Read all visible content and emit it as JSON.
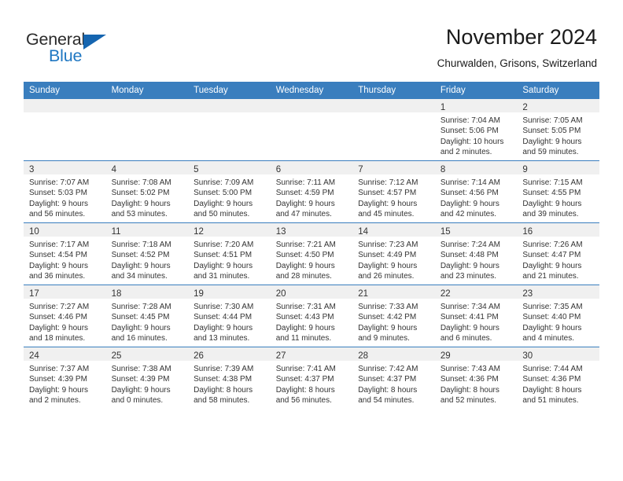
{
  "logo": {
    "word_top": "General",
    "word_bottom": "Blue",
    "triangle_icon": "triangle-icon",
    "color_blue": "#1565b0",
    "color_text": "#2b2b2b"
  },
  "header": {
    "title": "November 2024",
    "subtitle": "Churwalden, Grisons, Switzerland"
  },
  "theme": {
    "header_blue": "#3a7ebe",
    "daynum_band": "#f0f0f0",
    "text": "#333333"
  },
  "weekday_headers": [
    "Sunday",
    "Monday",
    "Tuesday",
    "Wednesday",
    "Thursday",
    "Friday",
    "Saturday"
  ],
  "weeks": [
    [
      {
        "empty": true
      },
      {
        "empty": true
      },
      {
        "empty": true
      },
      {
        "empty": true
      },
      {
        "empty": true
      },
      {
        "day": "1",
        "sunrise": "Sunrise: 7:04 AM",
        "sunset": "Sunset: 5:06 PM",
        "daylight_1": "Daylight: 10 hours",
        "daylight_2": "and 2 minutes."
      },
      {
        "day": "2",
        "sunrise": "Sunrise: 7:05 AM",
        "sunset": "Sunset: 5:05 PM",
        "daylight_1": "Daylight: 9 hours",
        "daylight_2": "and 59 minutes."
      }
    ],
    [
      {
        "day": "3",
        "sunrise": "Sunrise: 7:07 AM",
        "sunset": "Sunset: 5:03 PM",
        "daylight_1": "Daylight: 9 hours",
        "daylight_2": "and 56 minutes."
      },
      {
        "day": "4",
        "sunrise": "Sunrise: 7:08 AM",
        "sunset": "Sunset: 5:02 PM",
        "daylight_1": "Daylight: 9 hours",
        "daylight_2": "and 53 minutes."
      },
      {
        "day": "5",
        "sunrise": "Sunrise: 7:09 AM",
        "sunset": "Sunset: 5:00 PM",
        "daylight_1": "Daylight: 9 hours",
        "daylight_2": "and 50 minutes."
      },
      {
        "day": "6",
        "sunrise": "Sunrise: 7:11 AM",
        "sunset": "Sunset: 4:59 PM",
        "daylight_1": "Daylight: 9 hours",
        "daylight_2": "and 47 minutes."
      },
      {
        "day": "7",
        "sunrise": "Sunrise: 7:12 AM",
        "sunset": "Sunset: 4:57 PM",
        "daylight_1": "Daylight: 9 hours",
        "daylight_2": "and 45 minutes."
      },
      {
        "day": "8",
        "sunrise": "Sunrise: 7:14 AM",
        "sunset": "Sunset: 4:56 PM",
        "daylight_1": "Daylight: 9 hours",
        "daylight_2": "and 42 minutes."
      },
      {
        "day": "9",
        "sunrise": "Sunrise: 7:15 AM",
        "sunset": "Sunset: 4:55 PM",
        "daylight_1": "Daylight: 9 hours",
        "daylight_2": "and 39 minutes."
      }
    ],
    [
      {
        "day": "10",
        "sunrise": "Sunrise: 7:17 AM",
        "sunset": "Sunset: 4:54 PM",
        "daylight_1": "Daylight: 9 hours",
        "daylight_2": "and 36 minutes."
      },
      {
        "day": "11",
        "sunrise": "Sunrise: 7:18 AM",
        "sunset": "Sunset: 4:52 PM",
        "daylight_1": "Daylight: 9 hours",
        "daylight_2": "and 34 minutes."
      },
      {
        "day": "12",
        "sunrise": "Sunrise: 7:20 AM",
        "sunset": "Sunset: 4:51 PM",
        "daylight_1": "Daylight: 9 hours",
        "daylight_2": "and 31 minutes."
      },
      {
        "day": "13",
        "sunrise": "Sunrise: 7:21 AM",
        "sunset": "Sunset: 4:50 PM",
        "daylight_1": "Daylight: 9 hours",
        "daylight_2": "and 28 minutes."
      },
      {
        "day": "14",
        "sunrise": "Sunrise: 7:23 AM",
        "sunset": "Sunset: 4:49 PM",
        "daylight_1": "Daylight: 9 hours",
        "daylight_2": "and 26 minutes."
      },
      {
        "day": "15",
        "sunrise": "Sunrise: 7:24 AM",
        "sunset": "Sunset: 4:48 PM",
        "daylight_1": "Daylight: 9 hours",
        "daylight_2": "and 23 minutes."
      },
      {
        "day": "16",
        "sunrise": "Sunrise: 7:26 AM",
        "sunset": "Sunset: 4:47 PM",
        "daylight_1": "Daylight: 9 hours",
        "daylight_2": "and 21 minutes."
      }
    ],
    [
      {
        "day": "17",
        "sunrise": "Sunrise: 7:27 AM",
        "sunset": "Sunset: 4:46 PM",
        "daylight_1": "Daylight: 9 hours",
        "daylight_2": "and 18 minutes."
      },
      {
        "day": "18",
        "sunrise": "Sunrise: 7:28 AM",
        "sunset": "Sunset: 4:45 PM",
        "daylight_1": "Daylight: 9 hours",
        "daylight_2": "and 16 minutes."
      },
      {
        "day": "19",
        "sunrise": "Sunrise: 7:30 AM",
        "sunset": "Sunset: 4:44 PM",
        "daylight_1": "Daylight: 9 hours",
        "daylight_2": "and 13 minutes."
      },
      {
        "day": "20",
        "sunrise": "Sunrise: 7:31 AM",
        "sunset": "Sunset: 4:43 PM",
        "daylight_1": "Daylight: 9 hours",
        "daylight_2": "and 11 minutes."
      },
      {
        "day": "21",
        "sunrise": "Sunrise: 7:33 AM",
        "sunset": "Sunset: 4:42 PM",
        "daylight_1": "Daylight: 9 hours",
        "daylight_2": "and 9 minutes."
      },
      {
        "day": "22",
        "sunrise": "Sunrise: 7:34 AM",
        "sunset": "Sunset: 4:41 PM",
        "daylight_1": "Daylight: 9 hours",
        "daylight_2": "and 6 minutes."
      },
      {
        "day": "23",
        "sunrise": "Sunrise: 7:35 AM",
        "sunset": "Sunset: 4:40 PM",
        "daylight_1": "Daylight: 9 hours",
        "daylight_2": "and 4 minutes."
      }
    ],
    [
      {
        "day": "24",
        "sunrise": "Sunrise: 7:37 AM",
        "sunset": "Sunset: 4:39 PM",
        "daylight_1": "Daylight: 9 hours",
        "daylight_2": "and 2 minutes."
      },
      {
        "day": "25",
        "sunrise": "Sunrise: 7:38 AM",
        "sunset": "Sunset: 4:39 PM",
        "daylight_1": "Daylight: 9 hours",
        "daylight_2": "and 0 minutes."
      },
      {
        "day": "26",
        "sunrise": "Sunrise: 7:39 AM",
        "sunset": "Sunset: 4:38 PM",
        "daylight_1": "Daylight: 8 hours",
        "daylight_2": "and 58 minutes."
      },
      {
        "day": "27",
        "sunrise": "Sunrise: 7:41 AM",
        "sunset": "Sunset: 4:37 PM",
        "daylight_1": "Daylight: 8 hours",
        "daylight_2": "and 56 minutes."
      },
      {
        "day": "28",
        "sunrise": "Sunrise: 7:42 AM",
        "sunset": "Sunset: 4:37 PM",
        "daylight_1": "Daylight: 8 hours",
        "daylight_2": "and 54 minutes."
      },
      {
        "day": "29",
        "sunrise": "Sunrise: 7:43 AM",
        "sunset": "Sunset: 4:36 PM",
        "daylight_1": "Daylight: 8 hours",
        "daylight_2": "and 52 minutes."
      },
      {
        "day": "30",
        "sunrise": "Sunrise: 7:44 AM",
        "sunset": "Sunset: 4:36 PM",
        "daylight_1": "Daylight: 8 hours",
        "daylight_2": "and 51 minutes."
      }
    ]
  ]
}
